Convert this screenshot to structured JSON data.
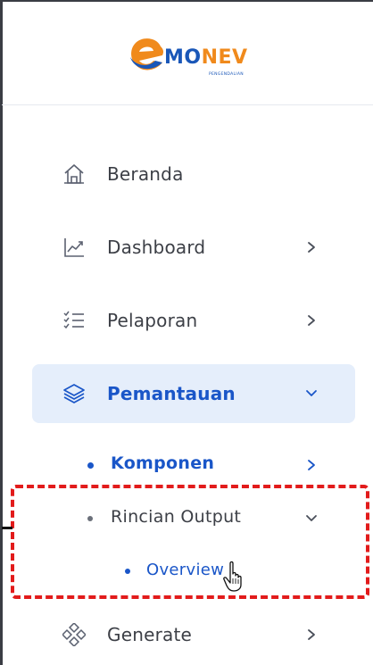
{
  "logo": {
    "text_mo": "MO",
    "text_nev": "NEV",
    "subtitle": "PENGENDALIAN"
  },
  "nav": {
    "items": [
      {
        "label": "Beranda",
        "icon": "home-icon"
      },
      {
        "label": "Dashboard",
        "icon": "chart-icon",
        "chevron": "right"
      },
      {
        "label": "Pelaporan",
        "icon": "checklist-icon",
        "chevron": "right"
      },
      {
        "label": "Pemantauan",
        "icon": "layers-icon",
        "chevron": "down",
        "active": true
      },
      {
        "label": "Generate",
        "icon": "diamond-grid-icon",
        "chevron": "right"
      }
    ],
    "submenu": [
      {
        "label": "Komponen",
        "chevron": "right"
      },
      {
        "label": "Rincian Output",
        "chevron": "down"
      }
    ],
    "subsubmenu": [
      {
        "label": "Overview"
      }
    ]
  },
  "colors": {
    "accent": "#1a56c8",
    "active_bg": "#e5eefb",
    "text": "#3c3f46",
    "highlight": "#e21b1b",
    "logo_blue": "#1a57b8",
    "logo_orange": "#f08a1c"
  }
}
